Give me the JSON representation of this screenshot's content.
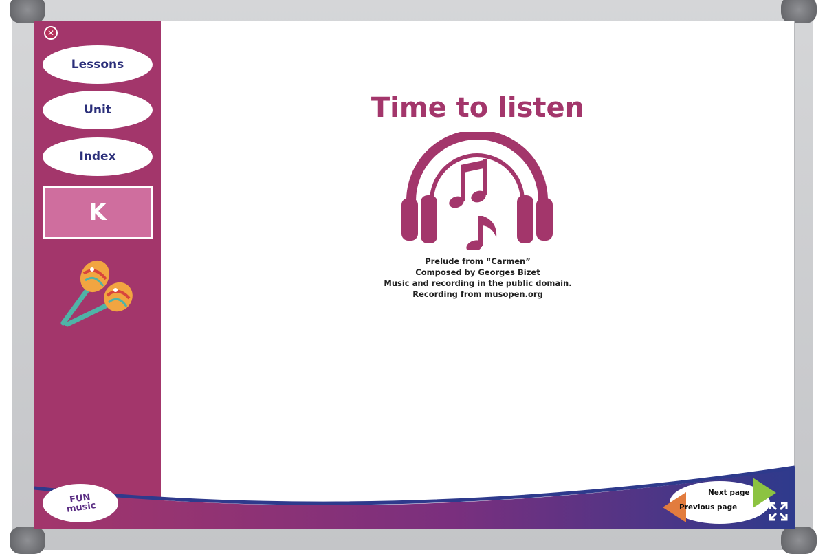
{
  "sidebar": {
    "close_icon": "close-icon",
    "items": [
      {
        "label": "Lessons"
      },
      {
        "label": "Unit"
      },
      {
        "label": "Index"
      }
    ],
    "grade_label": "K",
    "illustration": "maracas-icon"
  },
  "main": {
    "title": "Time to listen",
    "icon": "headphones-music-icon",
    "credits": {
      "line1": "Prelude from “Carmen”",
      "line2": "Composed by Georges Bizet",
      "line3": "Music and recording in the public domain.",
      "line4_prefix": "Recording from ",
      "line4_link": "musopen.org"
    }
  },
  "footer": {
    "logo_text_top": "FUN",
    "logo_text_bottom": "music",
    "next_label": "Next page",
    "prev_label": "Previous page",
    "fullscreen_icon": "fullscreen-icon"
  },
  "colors": {
    "sidebar": "#a3366b",
    "accent": "#a3366b",
    "grade_box": "#cf6e9e",
    "nav_text": "#2b2f7a",
    "footer_purple": "#6b2d84",
    "footer_navy": "#2e3a8c",
    "next_arrow": "#8cc341",
    "prev_arrow": "#e27c3e"
  }
}
